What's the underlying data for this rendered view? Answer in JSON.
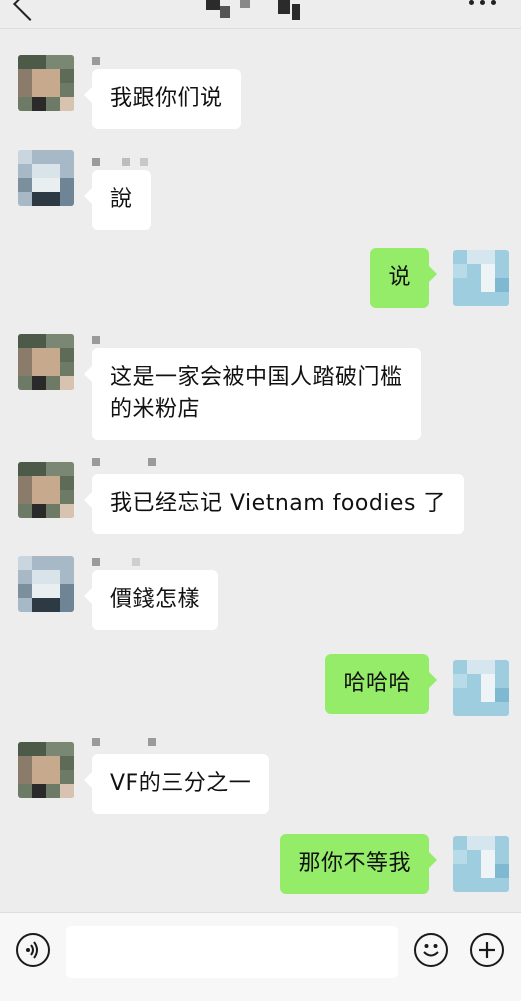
{
  "header": {
    "back_icon": "chevron-left-icon",
    "title": "",
    "more_icon": "more-dots-icon"
  },
  "messages": [
    {
      "side": "left",
      "avatar": "A",
      "text": "我跟你们说"
    },
    {
      "side": "left",
      "avatar": "B",
      "text": "說"
    },
    {
      "side": "right",
      "avatar": "me",
      "text": "说"
    },
    {
      "side": "left",
      "avatar": "A",
      "text": "这是一家会被中国人踏破门槛\n的米粉店"
    },
    {
      "side": "left",
      "avatar": "A",
      "text": "我已经忘记 Vietnam foodies 了"
    },
    {
      "side": "left",
      "avatar": "B",
      "text": "價錢怎樣"
    },
    {
      "side": "right",
      "avatar": "me",
      "text": "哈哈哈"
    },
    {
      "side": "left",
      "avatar": "A",
      "text": "VF的三分之一"
    },
    {
      "side": "right",
      "avatar": "me",
      "text": "那你不等我"
    }
  ],
  "input_bar": {
    "voice_icon": "voice-icon",
    "input_value": "",
    "emoji_icon": "emoji-icon",
    "plus_icon": "plus-icon"
  },
  "colors": {
    "background": "#ededed",
    "bubble_self": "#95ec69",
    "bubble_other": "#ffffff"
  }
}
